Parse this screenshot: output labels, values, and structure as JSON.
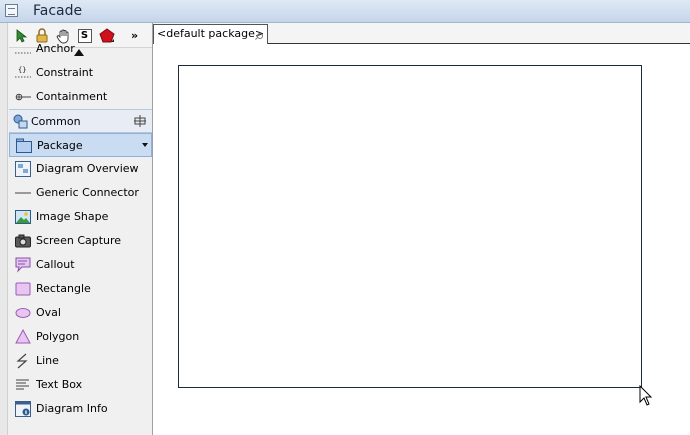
{
  "window": {
    "title": "Facade"
  },
  "palette": {
    "toolbar": {
      "s_label": "S",
      "more": "»"
    },
    "items_top": [
      {
        "label": "Anchor",
        "icon": "anchor-icon"
      },
      {
        "label": "Constraint",
        "icon": "constraint-icon"
      },
      {
        "label": "Containment",
        "icon": "containment-icon"
      }
    ],
    "group": {
      "label": "Common"
    },
    "items": [
      {
        "label": "Package",
        "icon": "package-icon"
      },
      {
        "label": "Diagram Overview",
        "icon": "diagram-overview-icon"
      },
      {
        "label": "Generic Connector",
        "icon": "generic-connector-icon"
      },
      {
        "label": "Image Shape",
        "icon": "image-shape-icon"
      },
      {
        "label": "Screen Capture",
        "icon": "camera-icon"
      },
      {
        "label": "Callout",
        "icon": "callout-icon"
      },
      {
        "label": "Rectangle",
        "icon": "rectangle-icon"
      },
      {
        "label": "Oval",
        "icon": "oval-icon"
      },
      {
        "label": "Polygon",
        "icon": "polygon-icon"
      },
      {
        "label": "Line",
        "icon": "line-icon"
      },
      {
        "label": "Text Box",
        "icon": "text-box-icon"
      },
      {
        "label": "Diagram Info",
        "icon": "diagram-info-icon"
      }
    ]
  },
  "diagram": {
    "tab_label": "<default package>"
  },
  "colors": {
    "selection": "#cadcf2",
    "frame": "#1e2a3a"
  }
}
